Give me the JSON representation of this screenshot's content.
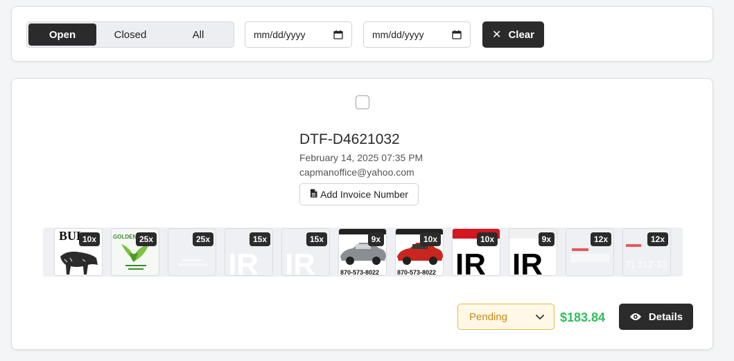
{
  "filters": {
    "tabs": [
      {
        "label": "Open",
        "active": true
      },
      {
        "label": "Closed",
        "active": false
      },
      {
        "label": "All",
        "active": false
      }
    ],
    "date_from_placeholder": "mm/dd/yyyy",
    "date_to_placeholder": "mm/dd/yyyy",
    "clear_label": "Clear",
    "clear_icon": "x-icon"
  },
  "order": {
    "id": "DTF-D4621032",
    "date": "February 14, 2025 07:35 PM",
    "email": "capmanoffice@yahoo.com",
    "invoice_button": "Add Invoice Number",
    "thumbnails": [
      {
        "qty": "10x",
        "art": "BUL"
      },
      {
        "qty": "25x",
        "art": "GOLDEN"
      },
      {
        "qty": "25x",
        "art": ""
      },
      {
        "qty": "15x",
        "art": "IR"
      },
      {
        "qty": "15x",
        "art": "IR"
      },
      {
        "qty": "9x",
        "art": "870-573-8022"
      },
      {
        "qty": "10x",
        "art": "870-573-8022"
      },
      {
        "qty": "10x",
        "art": "IR"
      },
      {
        "qty": "9x",
        "art": "IR"
      },
      {
        "qty": "12x",
        "art": ""
      },
      {
        "qty": "12x",
        "art": "7) 312-13"
      }
    ],
    "status": "Pending",
    "price": "$183.84",
    "details_label": "Details"
  },
  "colors": {
    "dark": "#2b2b2b",
    "pending_text": "#c88a12",
    "pending_border": "#e8b84a",
    "price": "#2fbf5a"
  }
}
